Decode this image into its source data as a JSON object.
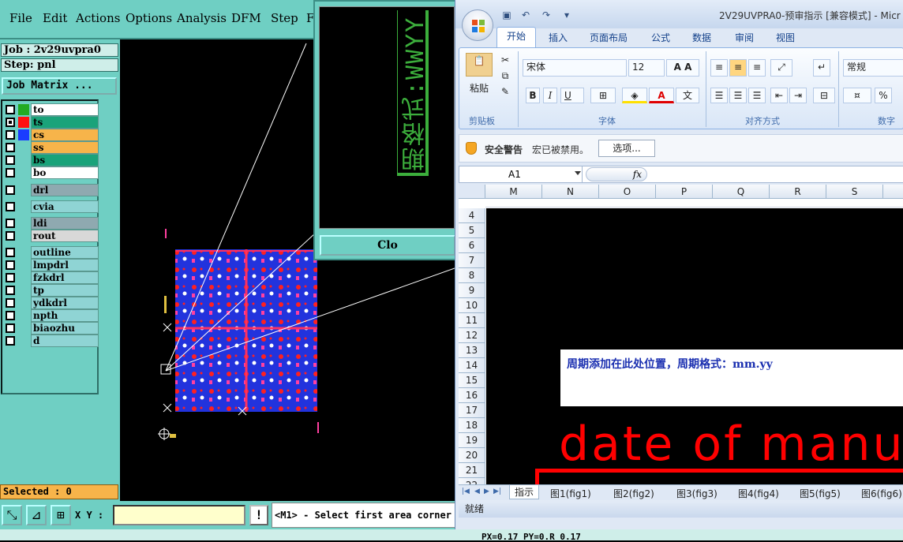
{
  "cam": {
    "menu": [
      "File",
      "Edit",
      "Actions",
      "Options",
      "Analysis",
      "DFM",
      "Step",
      "F"
    ],
    "job": "Job : 2v29uvpra0",
    "step": "Step: pnl",
    "job_matrix_label": "Job Matrix ...",
    "layers": [
      {
        "name": "to",
        "color": "#ffffff",
        "swatch": "#22aa22",
        "checked": false
      },
      {
        "name": "ts",
        "color": "#1aa37a",
        "swatch": "#ff1010",
        "checked": true
      },
      {
        "name": "cs",
        "color": "#f7b44a",
        "swatch": "#1a3cff",
        "checked": false
      },
      {
        "name": "ss",
        "color": "#f7b44a",
        "swatch": "",
        "checked": false
      },
      {
        "name": "bs",
        "color": "#1aa37a",
        "swatch": "",
        "checked": false
      },
      {
        "name": "bo",
        "color": "#ffffff",
        "swatch": "",
        "checked": false
      },
      {
        "name": "drl",
        "color": "#8fa9b0",
        "swatch": "",
        "checked": false
      },
      {
        "name": "cvia",
        "color": "#8fd4d4",
        "swatch": "",
        "checked": false
      },
      {
        "name": "ldi",
        "color": "#8fa9b0",
        "swatch": "",
        "checked": false
      },
      {
        "name": "rout",
        "color": "#d8d8d8",
        "swatch": "",
        "checked": false
      },
      {
        "name": "outline",
        "color": "#8fd4d4",
        "swatch": "",
        "checked": false
      },
      {
        "name": "lmpdrl",
        "color": "#8fd4d4",
        "swatch": "",
        "checked": false
      },
      {
        "name": "fzkdrl",
        "color": "#8fd4d4",
        "swatch": "",
        "checked": false
      },
      {
        "name": "tp",
        "color": "#8fd4d4",
        "swatch": "",
        "checked": false
      },
      {
        "name": "ydkdrl",
        "color": "#8fd4d4",
        "swatch": "",
        "checked": false
      },
      {
        "name": "npth",
        "color": "#8fd4d4",
        "swatch": "",
        "checked": false
      },
      {
        "name": "biaozhu",
        "color": "#8fd4d4",
        "swatch": "",
        "checked": false
      },
      {
        "name": "d",
        "color": "#8fd4d4",
        "swatch": "",
        "checked": false
      }
    ],
    "selected": "Selected : 0",
    "xy_label": "X Y :",
    "status_message": "<M1> - Select first area corner",
    "bottom_coords": "PX=0.17 PY=0.R 0.17",
    "popup_close_label": "Clo",
    "popup_text": "期格式:WWYY"
  },
  "excel": {
    "title": "2V29UVPRA0-预审指示  [兼容模式] - Micr",
    "tabs": [
      "开始",
      "插入",
      "页面布局",
      "公式",
      "数据",
      "审阅",
      "视图"
    ],
    "clipboard": {
      "paste": "粘贴",
      "group": "剪贴板"
    },
    "font": {
      "name": "宋体",
      "size": "12",
      "group": "字体",
      "bold": "B",
      "italic": "I",
      "underline": "U"
    },
    "alignment": {
      "group": "对齐方式"
    },
    "number": {
      "format": "常规",
      "group": "数字",
      "percent": "%"
    },
    "security": {
      "title": "安全警告",
      "message": "宏已被禁用。",
      "options": "选项..."
    },
    "name_box": "A1",
    "fx": "fx",
    "columns": [
      "M",
      "N",
      "O",
      "P",
      "Q",
      "R",
      "S"
    ],
    "rows": [
      "4",
      "5",
      "6",
      "7",
      "8",
      "9",
      "10",
      "11",
      "12",
      "13",
      "14",
      "15",
      "16",
      "17",
      "18",
      "19",
      "20",
      "21",
      "22"
    ],
    "note_text": "周期添加在此处位置，周期格式：mm.yy",
    "date_text": "date of manu",
    "sheets": [
      "指示",
      "图1(fig1)",
      "图2(fig2)",
      "图3(fig3)",
      "图4(fig4)",
      "图5(fig5)",
      "图6(fig6)"
    ],
    "status": "就绪"
  }
}
